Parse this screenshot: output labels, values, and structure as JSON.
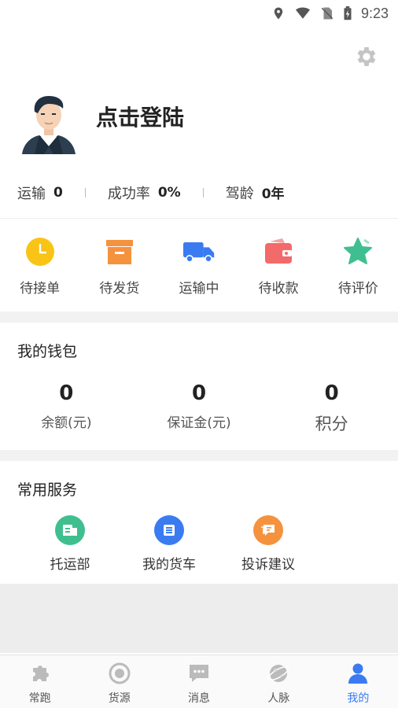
{
  "status_bar": {
    "time": "9:23",
    "icons": [
      "location-icon",
      "wifi-icon",
      "no-sim-icon",
      "battery-charging-icon"
    ]
  },
  "header": {
    "settings_icon": "gear-icon"
  },
  "profile": {
    "login_text": "点击登陆",
    "avatar_icon": "avatar-icon"
  },
  "stats": [
    {
      "label": "运输",
      "value": "0"
    },
    {
      "label": "成功率",
      "value": "0%"
    },
    {
      "label": "驾龄",
      "value": "0年"
    }
  ],
  "orders": [
    {
      "label": "待接单",
      "icon": "clock-icon",
      "color": "#f9c416"
    },
    {
      "label": "待发货",
      "icon": "box-icon",
      "color": "#f5923e"
    },
    {
      "label": "运输中",
      "icon": "truck-icon",
      "color": "#3a7bf2"
    },
    {
      "label": "待收款",
      "icon": "wallet-icon",
      "color": "#f26a6a"
    },
    {
      "label": "待评价",
      "icon": "star-icon",
      "color": "#3fbf8f"
    }
  ],
  "wallet": {
    "title": "我的钱包",
    "items": [
      {
        "value": "0",
        "label": "余额(元)"
      },
      {
        "value": "0",
        "label": "保证金(元)"
      },
      {
        "value": "0",
        "label": "积分"
      }
    ]
  },
  "services": {
    "title": "常用服务",
    "items": [
      {
        "label": "托运部",
        "icon": "consign-icon",
        "color": "#3fbf8f"
      },
      {
        "label": "我的货车",
        "icon": "my-truck-icon",
        "color": "#3a7bf2"
      },
      {
        "label": "投诉建议",
        "icon": "feedback-icon",
        "color": "#f5923e"
      }
    ]
  },
  "bottom_nav": [
    {
      "label": "常跑",
      "icon": "puzzle-icon"
    },
    {
      "label": "货源",
      "icon": "target-icon"
    },
    {
      "label": "消息",
      "icon": "message-icon"
    },
    {
      "label": "人脉",
      "icon": "planet-icon"
    },
    {
      "label": "我的",
      "icon": "person-icon",
      "active": true
    }
  ],
  "colors": {
    "accent": "#3a7bf2",
    "nav_inactive": "#bbbbbb",
    "background_gap": "#f2f2f2"
  }
}
